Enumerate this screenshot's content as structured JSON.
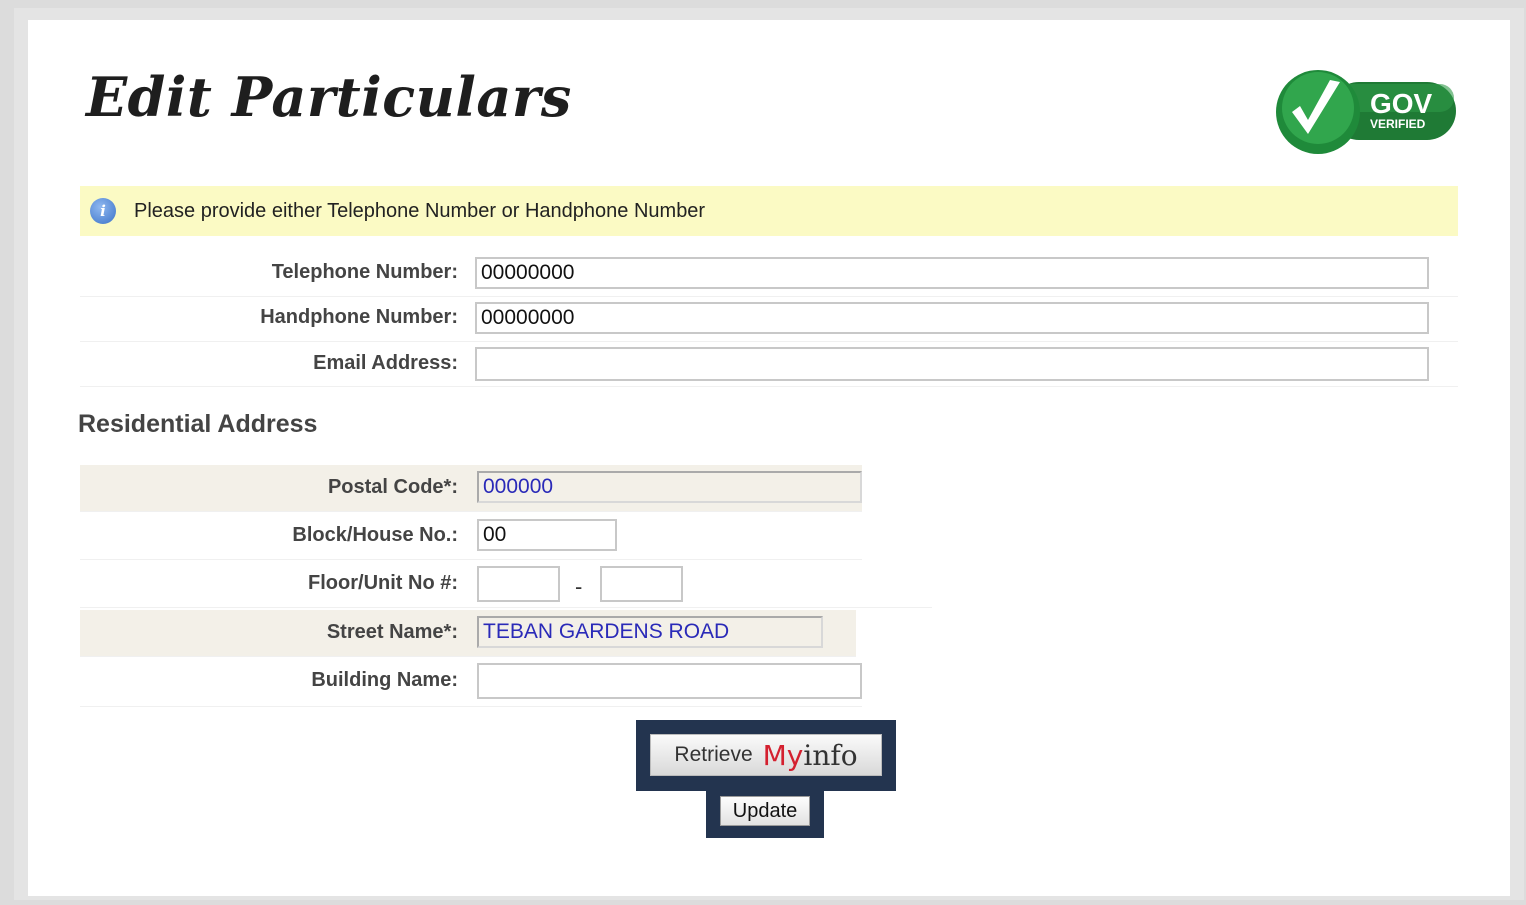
{
  "page": {
    "title": "Edit Particulars",
    "badge": {
      "line1": "GOV",
      "line2": "VERIFIED",
      "icon": "checkmark-icon",
      "color": "#1f8a3a"
    }
  },
  "notice": {
    "icon": "info-icon",
    "text": "Please provide either Telephone Number or Handphone Number",
    "background": "#fbfac4"
  },
  "contact": {
    "telephone": {
      "label": "Telephone Number:",
      "value": "00000000"
    },
    "handphone": {
      "label": "Handphone Number:",
      "value": "00000000"
    },
    "email": {
      "label": "Email Address:",
      "value": ""
    }
  },
  "address": {
    "heading": "Residential Address",
    "postal_code": {
      "label": "Postal Code*:",
      "value": "000000"
    },
    "block": {
      "label": "Block/House No.:",
      "value": "00"
    },
    "floor_unit": {
      "label": "Floor/Unit No #:",
      "floor": "",
      "separator": "-",
      "unit": ""
    },
    "street": {
      "label": "Street Name*:",
      "value": "TEBAN GARDENS ROAD"
    },
    "building": {
      "label": "Building Name:",
      "value": ""
    }
  },
  "actions": {
    "retrieve_label": "Retrieve",
    "myinfo_my": "My",
    "myinfo_info": "info",
    "update_label": "Update"
  },
  "colors": {
    "highlight_frame": "#23344f",
    "readonly_text": "#2a2ab8",
    "myinfo_red": "#d4202f"
  }
}
